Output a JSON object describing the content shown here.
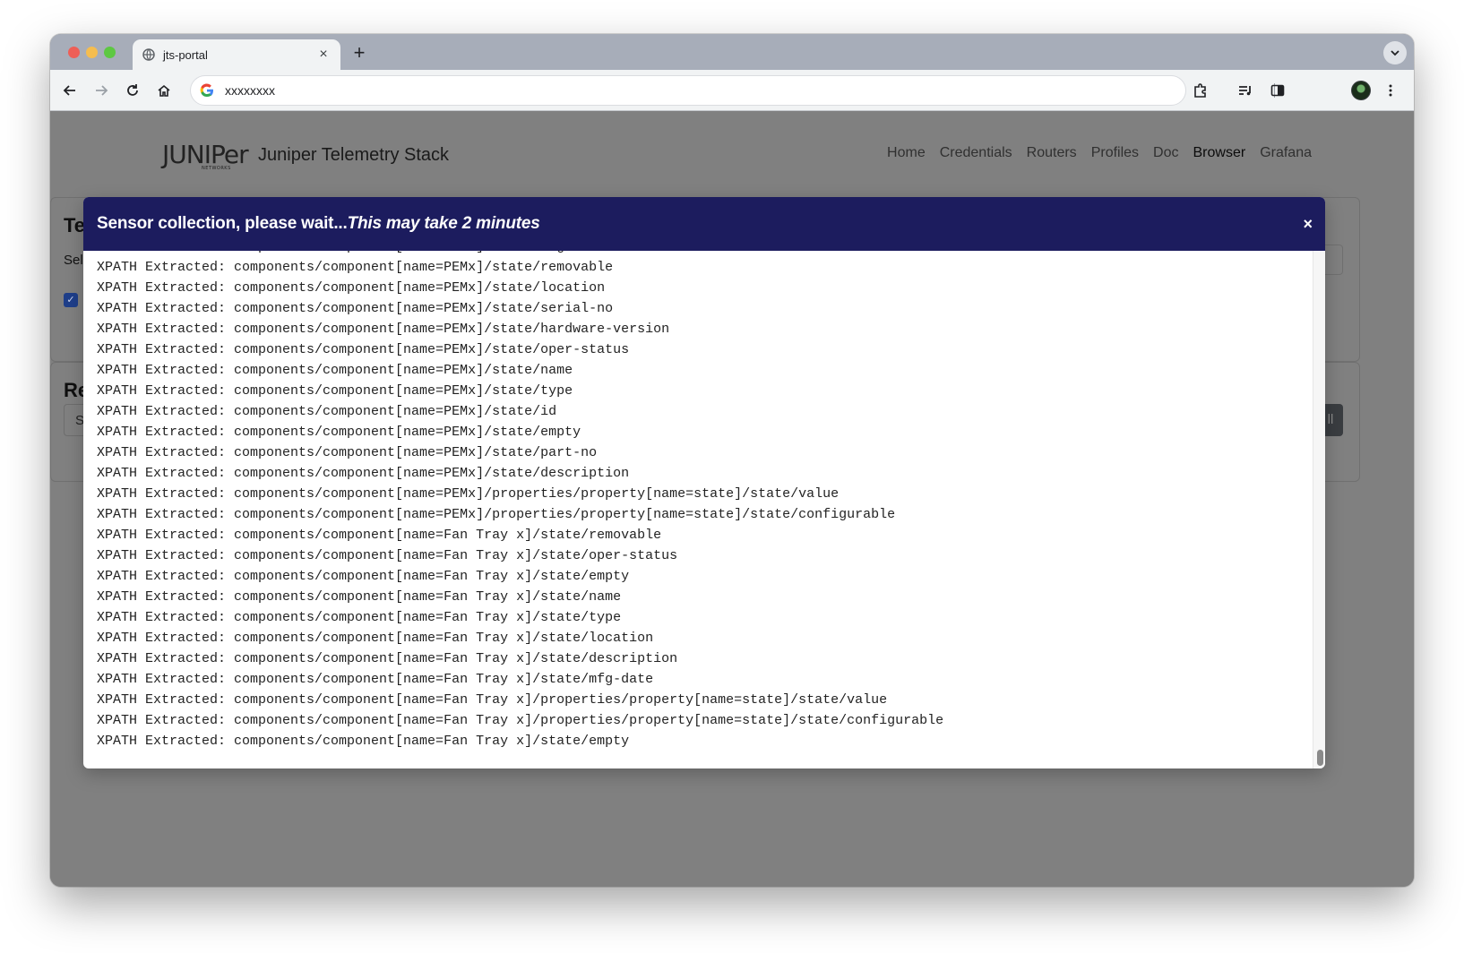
{
  "browser": {
    "tab_title": "jts-portal",
    "tab_close": "×",
    "new_tab": "+",
    "url": "xxxxxxxx"
  },
  "navbar": {
    "logo_text": "JUNIPer",
    "logo_sub": "NETWORKS",
    "brand_name": "Juniper Telemetry Stack",
    "links": [
      "Home",
      "Credentials",
      "Routers",
      "Profiles",
      "Doc",
      "Browser",
      "Grafana"
    ]
  },
  "background": {
    "card1_heading": "Te",
    "card1_sub": "Sel",
    "card2_heading": "Re",
    "card2_input": "S",
    "card2_button": "ll"
  },
  "modal": {
    "title_main": "Sensor collection, please wait...",
    "title_note": "This may take 2 minutes",
    "close": "×",
    "log_lines": [
      "XPATH Extracted: components/component[name=PEMx]/state/mfg-date",
      "XPATH Extracted: components/component[name=PEMx]/state/removable",
      "XPATH Extracted: components/component[name=PEMx]/state/location",
      "XPATH Extracted: components/component[name=PEMx]/state/serial-no",
      "XPATH Extracted: components/component[name=PEMx]/state/hardware-version",
      "XPATH Extracted: components/component[name=PEMx]/state/oper-status",
      "XPATH Extracted: components/component[name=PEMx]/state/name",
      "XPATH Extracted: components/component[name=PEMx]/state/type",
      "XPATH Extracted: components/component[name=PEMx]/state/id",
      "XPATH Extracted: components/component[name=PEMx]/state/empty",
      "XPATH Extracted: components/component[name=PEMx]/state/part-no",
      "XPATH Extracted: components/component[name=PEMx]/state/description",
      "XPATH Extracted: components/component[name=PEMx]/properties/property[name=state]/state/value",
      "XPATH Extracted: components/component[name=PEMx]/properties/property[name=state]/state/configurable",
      "XPATH Extracted: components/component[name=Fan Tray x]/state/removable",
      "XPATH Extracted: components/component[name=Fan Tray x]/state/oper-status",
      "XPATH Extracted: components/component[name=Fan Tray x]/state/empty",
      "XPATH Extracted: components/component[name=Fan Tray x]/state/name",
      "XPATH Extracted: components/component[name=Fan Tray x]/state/type",
      "XPATH Extracted: components/component[name=Fan Tray x]/state/location",
      "XPATH Extracted: components/component[name=Fan Tray x]/state/description",
      "XPATH Extracted: components/component[name=Fan Tray x]/state/mfg-date",
      "XPATH Extracted: components/component[name=Fan Tray x]/properties/property[name=state]/state/value",
      "XPATH Extracted: components/component[name=Fan Tray x]/properties/property[name=state]/state/configurable",
      "XPATH Extracted: components/component[name=Fan Tray x]/state/empty"
    ]
  },
  "colors": {
    "modal_header": "#1c1c5e",
    "overlay": "#808080",
    "checkbox": "#1f3f8a"
  }
}
